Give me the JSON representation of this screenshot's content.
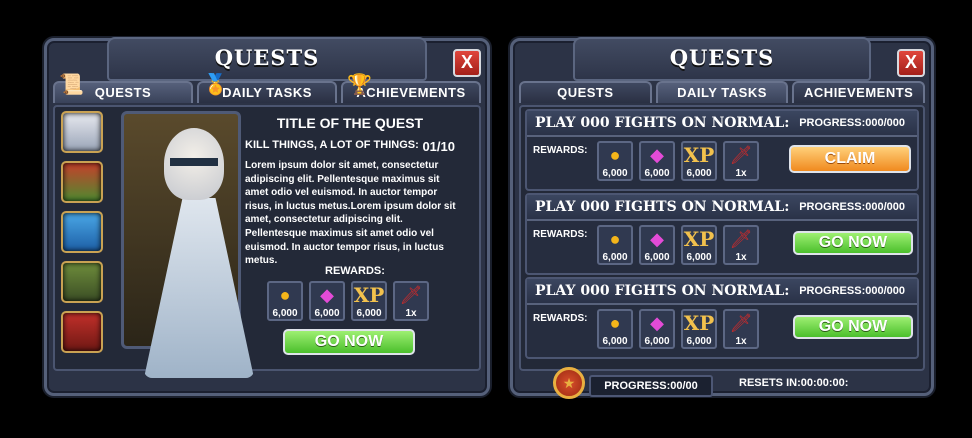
{
  "left": {
    "title": "QUESTS",
    "close": "X",
    "tabs": [
      {
        "label": "QUESTS",
        "icon": "scroll-icon"
      },
      {
        "label": "DAILY TASKS",
        "icon": "medal-icon"
      },
      {
        "label": "ACHIEVEMENTS",
        "icon": "trophy-icon"
      }
    ],
    "quest_title": "TITLE OF THE QUEST",
    "quest_sub": "KILL THINGS, A LOT OF THINGS:",
    "quest_count": "01/10",
    "description": "Lorem ipsum dolor sit amet, consectetur adipiscing elit. Pellentesque maximus sit amet odio vel euismod. In auctor tempor risus, in luctus metus.Lorem ipsum dolor sit amet, consectetur adipiscing elit. Pellentesque maximus sit amet odio vel euismod. In auctor tempor risus, in luctus metus.",
    "rewards_label": "REWARDS:",
    "rewards": [
      {
        "icon": "coin-icon",
        "qty": "6,000"
      },
      {
        "icon": "gem-icon",
        "qty": "6,000"
      },
      {
        "icon": "xp-icon",
        "text": "XP",
        "qty": "6,000"
      },
      {
        "icon": "sword-icon",
        "qty": "1x"
      }
    ],
    "button": "GO NOW"
  },
  "right": {
    "title": "QUESTS",
    "close": "X",
    "tabs": [
      {
        "label": "QUESTS"
      },
      {
        "label": "DAILY TASKS"
      },
      {
        "label": "ACHIEVEMENTS"
      }
    ],
    "rows": [
      {
        "title": "PLAY 000 FIGHTS ON NORMAL:",
        "progress": "PROGRESS:000/000",
        "rewards_label": "REWARDS:",
        "button": "CLAIM"
      },
      {
        "title": "PLAY 000 FIGHTS ON NORMAL:",
        "progress": "PROGRESS:000/000",
        "rewards_label": "REWARDS:",
        "button": "GO NOW"
      },
      {
        "title": "PLAY 000 FIGHTS ON NORMAL:",
        "progress": "PROGRESS:000/000",
        "rewards_label": "REWARDS:",
        "button": "GO NOW"
      }
    ],
    "rewards": [
      {
        "icon": "coin-icon",
        "qty": "6,000"
      },
      {
        "icon": "gem-icon",
        "qty": "6,000"
      },
      {
        "icon": "xp-icon",
        "text": "XP",
        "qty": "6,000"
      },
      {
        "icon": "sword-icon",
        "qty": "1x"
      }
    ],
    "footer_progress": "PROGRESS:00/00",
    "footer_resets": "RESETS IN:00:00:00:"
  }
}
